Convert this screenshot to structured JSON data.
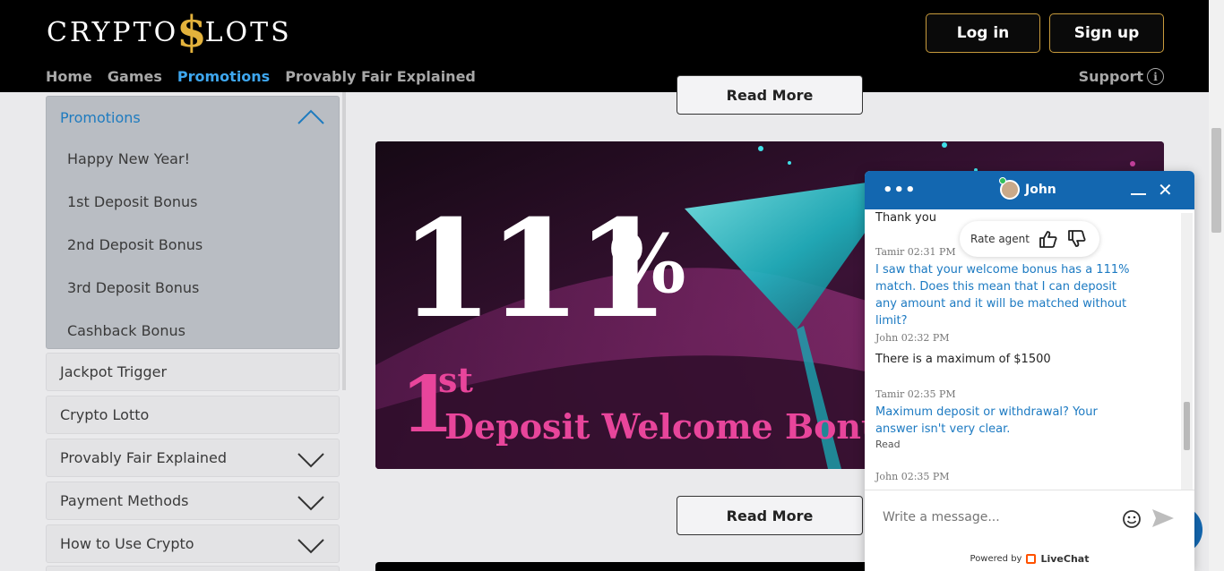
{
  "header": {
    "logo_left": "CRYPTO",
    "logo_dollar": "$",
    "logo_right": "LOTS",
    "login_label": "Log in",
    "signup_label": "Sign up",
    "nav": [
      "Home",
      "Games",
      "Promotions",
      "Provably Fair Explained"
    ],
    "nav_active": "Promotions",
    "support_label": "Support",
    "support_icon": "info-icon"
  },
  "sidebar": {
    "open_section": {
      "title": "Promotions",
      "items": [
        "Happy New Year!",
        "1st Deposit Bonus",
        "2nd Deposit Bonus",
        "3rd Deposit Bonus",
        "Cashback Bonus"
      ]
    },
    "sections": [
      {
        "label": "Jackpot Trigger",
        "expandable": false
      },
      {
        "label": "Crypto Lotto",
        "expandable": false
      },
      {
        "label": "Provably Fair Explained",
        "expandable": true
      },
      {
        "label": "Payment Methods",
        "expandable": true
      },
      {
        "label": "How to Use Crypto",
        "expandable": true
      }
    ]
  },
  "content": {
    "read_more_top": "Read More",
    "read_more_bottom": "Read More",
    "banner": {
      "big_number": "111",
      "percent": "%",
      "one": "1",
      "st": "st",
      "subtitle": "Deposit Welcome Bonu"
    }
  },
  "chat": {
    "agent_name": "John",
    "menu_icon": "more-dots-icon",
    "rate_label": "Rate agent",
    "messages": [
      {
        "meta": "",
        "text": "Thank you",
        "from": "agent"
      },
      {
        "meta": "Tamir 02:31 PM",
        "text": "I saw that your welcome bonus has a 111% match. Does this mean that I can deposit any amount and it will be matched without limit?",
        "from": "user"
      },
      {
        "meta": "John 02:32 PM",
        "text": "There is a maximum of $1500",
        "from": "agent"
      },
      {
        "meta": "Tamir 02:35 PM",
        "text": "Maximum deposit or withdrawal? Your answer isn't very clear.",
        "from": "user",
        "status": "Read"
      },
      {
        "meta": "John 02:35 PM",
        "text": "",
        "from": "agent"
      }
    ],
    "input_placeholder": "Write a message...",
    "powered_by": "Powered by",
    "brand": "LiveChat"
  },
  "colors": {
    "accent_blue": "#3ea7ef",
    "chat_blue": "#1367b0",
    "gold": "#c89b3c",
    "banner_pink": "#e8459b"
  }
}
